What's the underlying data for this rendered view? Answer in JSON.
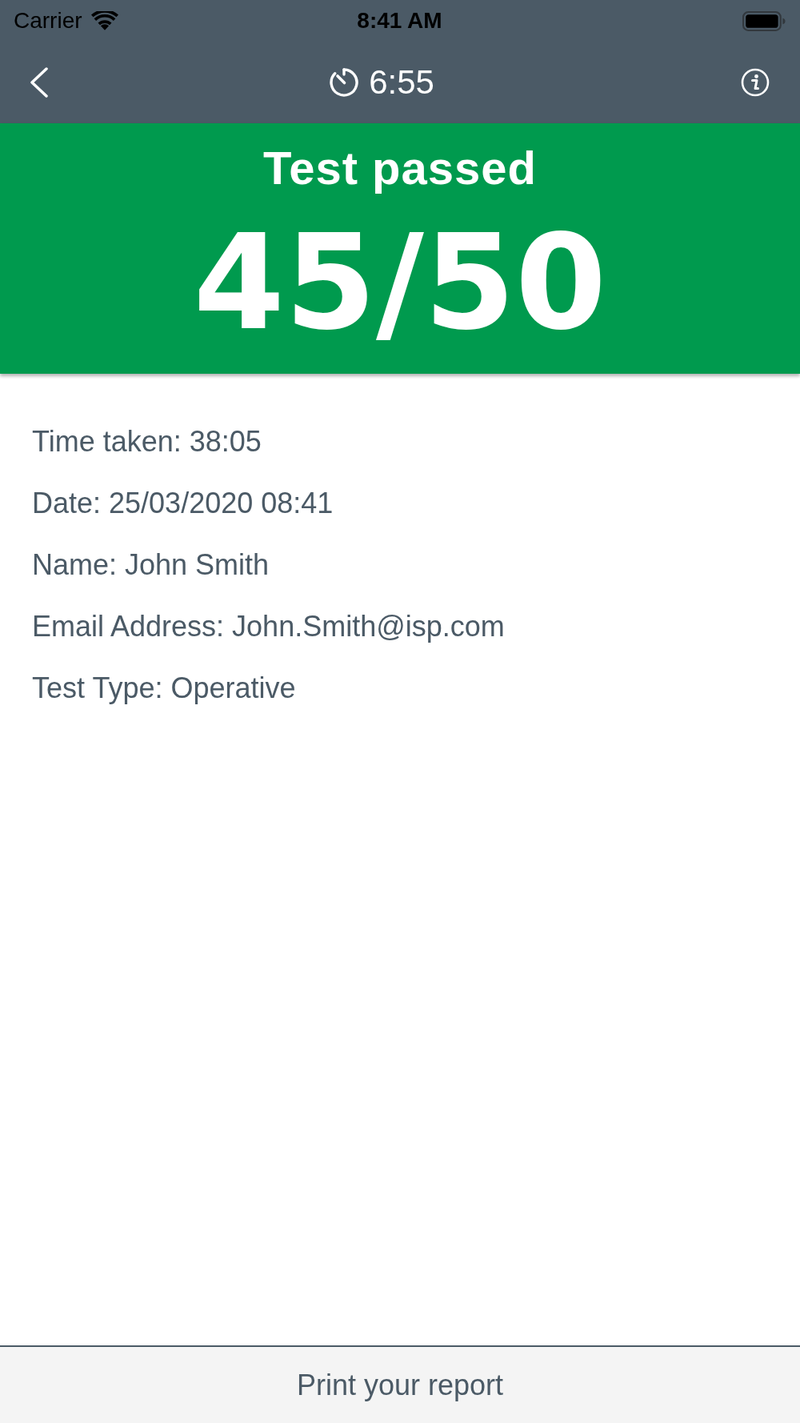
{
  "status_bar": {
    "carrier": "Carrier",
    "time": "8:41 AM"
  },
  "nav_bar": {
    "timer": "6:55"
  },
  "result": {
    "passed": true,
    "title": "Test passed",
    "score": "45/50"
  },
  "details": [
    "Time taken: 38:05",
    "Date: 25/03/2020 08:41",
    "Name: John Smith",
    "Email Address: John.Smith@isp.com",
    "Test Type: Operative"
  ],
  "footer": {
    "button": "Print your report"
  }
}
